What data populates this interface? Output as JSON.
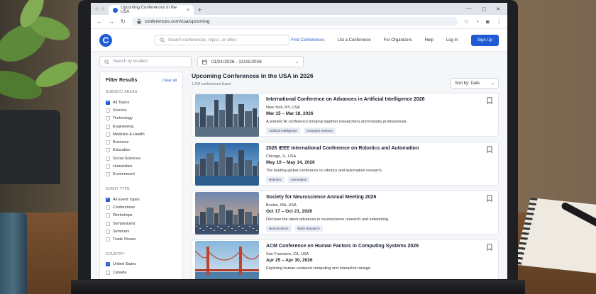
{
  "browser": {
    "tab_title": "Upcoming Conferences in the USA",
    "tab_close": "×",
    "new_tab": "+",
    "url": "conferences.com/usa/upcoming",
    "win_min": "—",
    "win_max": "▢",
    "win_close": "✕"
  },
  "site": {
    "logo_letter": "C",
    "search_placeholder": "Search conferences, topics, or cities",
    "nav": {
      "find": "Find Conferences",
      "list": "List a Conference",
      "organizers": "For Organizers",
      "help": "Help",
      "login": "Log In",
      "signup": "Sign Up"
    }
  },
  "filters": {
    "location_placeholder": "Search by location",
    "date_range": "01/01/2026 - 12/31/2026"
  },
  "sidebar": {
    "title": "Filter Results",
    "clear_all": "Clear all",
    "subject_heading": "SUBJECT AREAS",
    "subjects": [
      {
        "label": "All Topics",
        "checked": true
      },
      {
        "label": "Science",
        "checked": false
      },
      {
        "label": "Technology",
        "checked": false
      },
      {
        "label": "Engineering",
        "checked": false
      },
      {
        "label": "Medicine & Health",
        "checked": false
      },
      {
        "label": "Business",
        "checked": false
      },
      {
        "label": "Education",
        "checked": false
      },
      {
        "label": "Social Sciences",
        "checked": false
      },
      {
        "label": "Humanities",
        "checked": false
      },
      {
        "label": "Environment",
        "checked": false
      }
    ],
    "event_heading": "EVENT TYPE",
    "events": [
      {
        "label": "All Event Types",
        "checked": true
      },
      {
        "label": "Conferences",
        "checked": false
      },
      {
        "label": "Workshops",
        "checked": false
      },
      {
        "label": "Symposiums",
        "checked": false
      },
      {
        "label": "Seminars",
        "checked": false
      },
      {
        "label": "Trade Shows",
        "checked": false
      }
    ],
    "country_heading": "COUNTRY",
    "countries": [
      {
        "label": "United States",
        "checked": true
      },
      {
        "label": "Canada",
        "checked": false
      }
    ]
  },
  "main": {
    "title": "Upcoming Conferences in the USA in 2026",
    "count": "1,234 conferences found",
    "sort_label": "Sort by: Date"
  },
  "conferences": [
    {
      "title": "International Conference on Advances in Artificial Intelligence 2026",
      "location": "New York, NY, USA",
      "dates": "Mar 15 – Mar 18, 2026",
      "description": "A premier AI conference bringing together researchers and industry professionals.",
      "tags": [
        "Artificial Intelligence",
        "Computer Science"
      ],
      "image": "new-york-skyline"
    },
    {
      "title": "2026 IEEE International Conference on Robotics and Automation",
      "location": "Chicago, IL, USA",
      "dates": "May 10 – May 14, 2026",
      "description": "The leading global conference in robotics and automation research.",
      "tags": [
        "Robotics",
        "Automation"
      ],
      "image": "chicago-skyline"
    },
    {
      "title": "Society for Neuroscience Annual Meeting 2026",
      "location": "Boston, MA, USA",
      "dates": "Oct 17 – Oct 21, 2026",
      "description": "Discover the latest advances in neuroscience research and networking.",
      "tags": [
        "Neuroscience",
        "Brain Research"
      ],
      "image": "boston-skyline"
    },
    {
      "title": "ACM Conference on Human Factors in Computing Systems 2026",
      "location": "San Francisco, CA, USA",
      "dates": "Apr 25 – Apr 30, 2026",
      "description": "Exploring human-centered computing and interaction design.",
      "tags": [],
      "image": "golden-gate-bridge"
    }
  ],
  "colors": {
    "accent": "#1f5bd4",
    "tag_bg": "#e8edf5"
  }
}
